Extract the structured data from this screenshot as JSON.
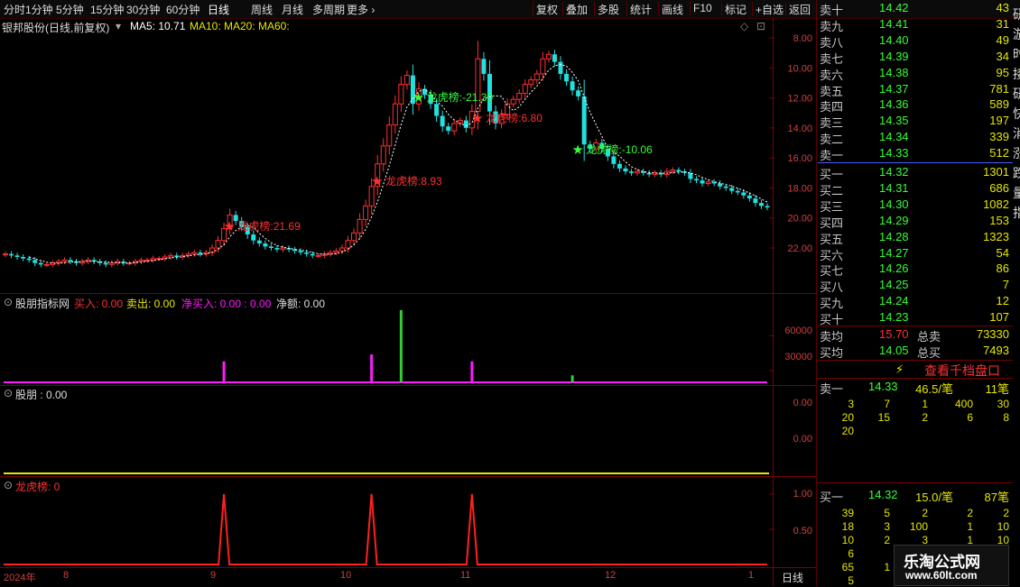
{
  "toolbar": {
    "periods": [
      "分时",
      "1分钟",
      "5分钟",
      "15分钟",
      "30分钟",
      "60分钟",
      "日线",
      "周线",
      "月线",
      "多周期",
      "更多"
    ],
    "tools": [
      "复权",
      "叠加",
      "多股",
      "统计",
      "画线",
      "F10",
      "标记",
      "+自选",
      "返回"
    ]
  },
  "main_chart": {
    "stock_label": "银邦股份(日线,前复权)",
    "ma5": "MA5: 10.71",
    "ma10": "MA10:",
    "ma20": "MA20:",
    "ma60": "MA60:",
    "annotations": [
      {
        "text": "★ 龙虎榜:21.69",
        "price": 9.2,
        "idx": 37,
        "color": "#ff3030"
      },
      {
        "text": "★ 龙虎榜:8.93",
        "price": 12.2,
        "idx": 62,
        "color": "#ff3030"
      },
      {
        "text": "★ 龙虎榜:-21.30",
        "price": 17.8,
        "idx": 69,
        "color": "#33ff33"
      },
      {
        "text": "★ 龙虎榜:6.80",
        "price": 16.4,
        "idx": 79,
        "color": "#ff3030"
      },
      {
        "text": "★ 龙虎榜:-10.06",
        "price": 14.3,
        "idx": 96,
        "color": "#33ff33"
      }
    ],
    "y_ticks": [
      "22.00",
      "20.00",
      "18.00",
      "16.00",
      "14.00",
      "12.00",
      "10.00",
      "8.00"
    ]
  },
  "chart_data": [
    {
      "type": "candlestick",
      "title": "银邦股份(日线,前复权)",
      "ylim": [
        6.5,
        22.6
      ],
      "y_ticks": [
        8,
        10,
        12,
        14,
        16,
        18,
        20,
        22
      ],
      "x_labels": [
        "2024年",
        "8",
        "9",
        "10",
        "11",
        "12",
        "1"
      ],
      "close": [
        7.6,
        7.5,
        7.4,
        7.3,
        7.2,
        7.0,
        6.9,
        6.9,
        7.0,
        7.1,
        7.2,
        7.1,
        7.0,
        7.1,
        7.2,
        7.1,
        7.0,
        6.9,
        7.0,
        7.1,
        7.0,
        7.0,
        7.1,
        7.2,
        7.2,
        7.3,
        7.3,
        7.4,
        7.5,
        7.4,
        7.5,
        7.6,
        7.7,
        7.6,
        7.7,
        8.0,
        8.5,
        9.3,
        10.2,
        9.8,
        9.4,
        8.9,
        8.5,
        8.3,
        8.1,
        8.0,
        7.9,
        8.0,
        7.9,
        7.8,
        7.7,
        7.6,
        7.5,
        7.5,
        7.6,
        7.7,
        7.8,
        8.0,
        8.5,
        9.0,
        9.9,
        10.8,
        12.1,
        13.6,
        14.8,
        16.2,
        17.6,
        18.9,
        19.5,
        17.6,
        18.6,
        18.2,
        17.6,
        16.8,
        16.1,
        15.8,
        16.3,
        16.5,
        16.0,
        17.1,
        20.6,
        19.6,
        17.1,
        16.3,
        16.9,
        17.6,
        17.9,
        18.3,
        18.9,
        19.2,
        19.6,
        20.6,
        20.9,
        20.4,
        19.6,
        19.1,
        18.5,
        18.1,
        14.9,
        14.6,
        15.0,
        14.6,
        14.1,
        13.6,
        13.3,
        13.1,
        13.0,
        13.1,
        13.0,
        12.9,
        13.0,
        12.9,
        13.1,
        13.2,
        13.1,
        13.0,
        12.6,
        12.5,
        12.3,
        12.4,
        12.3,
        12.1,
        12.0,
        11.8,
        11.7,
        11.5,
        11.3,
        11.0,
        10.8,
        10.7
      ]
    },
    {
      "type": "bar",
      "title": "股朋指标网",
      "ylim": [
        20000,
        85000
      ],
      "y_ticks": [
        30000,
        60000
      ],
      "series": [
        {
          "name": "买入",
          "values": [
            {
              "idx": 37,
              "v": 38000,
              "color": "#ff1aff"
            },
            {
              "idx": 62,
              "v": 44000,
              "color": "#ff1aff"
            },
            {
              "idx": 67,
              "v": 82000,
              "color": "#33cc33"
            },
            {
              "idx": 79,
              "v": 38000,
              "color": "#ff1aff"
            },
            {
              "idx": 96,
              "v": 26000,
              "color": "#33cc33"
            }
          ]
        }
      ]
    },
    {
      "type": "line",
      "title": "龙虎榜",
      "ylim": [
        0,
        1.1
      ],
      "y_ticks": [
        0.5,
        1.0
      ],
      "spikes": [
        37,
        62,
        79
      ]
    }
  ],
  "sub1": {
    "title": "股朋指标网",
    "buy": "买入: 0.00",
    "sell": "卖出: 0.00",
    "netbuy": "净买入: 0.00 : 0.00",
    "netamt": "净额: 0.00",
    "ticks": [
      "60000",
      "30000"
    ]
  },
  "sub2": {
    "title": "股朋 : 0.00",
    "ticks": [
      "0.00",
      "0.00"
    ]
  },
  "sub3": {
    "title": "龙虎榜: 0",
    "ticks": [
      "1.00",
      "0.50"
    ]
  },
  "xaxis": [
    "2024年",
    "8",
    "9",
    "10",
    "11",
    "12",
    "1"
  ],
  "right_tab": "日线",
  "order_book": {
    "asks": [
      {
        "n": "卖十",
        "p": "14.42",
        "v": "43"
      },
      {
        "n": "卖九",
        "p": "14.41",
        "v": "31"
      },
      {
        "n": "卖八",
        "p": "14.40",
        "v": "49"
      },
      {
        "n": "卖七",
        "p": "14.39",
        "v": "34"
      },
      {
        "n": "卖六",
        "p": "14.38",
        "v": "95"
      },
      {
        "n": "卖五",
        "p": "14.37",
        "v": "781"
      },
      {
        "n": "卖四",
        "p": "14.36",
        "v": "589"
      },
      {
        "n": "卖三",
        "p": "14.35",
        "v": "197"
      },
      {
        "n": "卖二",
        "p": "14.34",
        "v": "339"
      },
      {
        "n": "卖一",
        "p": "14.33",
        "v": "512"
      }
    ],
    "bids": [
      {
        "n": "买一",
        "p": "14.32",
        "v": "1301"
      },
      {
        "n": "买二",
        "p": "14.31",
        "v": "686"
      },
      {
        "n": "买三",
        "p": "14.30",
        "v": "1082"
      },
      {
        "n": "买四",
        "p": "14.29",
        "v": "153"
      },
      {
        "n": "买五",
        "p": "14.28",
        "v": "1323"
      },
      {
        "n": "买六",
        "p": "14.27",
        "v": "54"
      },
      {
        "n": "买七",
        "p": "14.26",
        "v": "86"
      },
      {
        "n": "买八",
        "p": "14.25",
        "v": "7"
      },
      {
        "n": "买九",
        "p": "14.24",
        "v": "12"
      },
      {
        "n": "买十",
        "p": "14.23",
        "v": "107"
      }
    ],
    "avg_sell_label": "卖均",
    "avg_sell": "15.70",
    "total_sell_label": "总卖",
    "total_sell": "73330",
    "avg_buy_label": "买均",
    "avg_buy": "14.05",
    "total_buy_label": "总买",
    "total_buy": "7493",
    "view_button": "查看千档盘口"
  },
  "queue_sell": {
    "label": "卖一",
    "price": "14.33",
    "avg": "46.5/笔",
    "count": "11笔",
    "rows": [
      [
        "3",
        "7",
        "1",
        "400",
        "30"
      ],
      [
        "20",
        "15",
        "2",
        "6",
        "8"
      ],
      [
        "20",
        "",
        "",
        "",
        ""
      ]
    ]
  },
  "queue_buy": {
    "label": "买一",
    "price": "14.32",
    "avg": "15.0/笔",
    "count": "87笔",
    "rows": [
      [
        "39",
        "5",
        "2",
        "2",
        "2"
      ],
      [
        "18",
        "3",
        "100",
        "1",
        "10"
      ],
      [
        "10",
        "2",
        "3",
        "1",
        "10"
      ],
      [
        "6",
        "",
        "",
        "",
        ""
      ],
      [
        "65",
        "1",
        "",
        "",
        ""
      ],
      [
        "5",
        "",
        "",
        "",
        ""
      ]
    ]
  },
  "side_strip": [
    "研",
    "游",
    "时",
    "接",
    "研",
    "快",
    "消",
    "涨",
    "跌",
    "量",
    "指"
  ],
  "watermark": {
    "title": "乐淘公式网",
    "url": "www.60lt.com"
  },
  "colors": {
    "up": "#ff3030",
    "down": "#22e0e0",
    "ma": "#ffffff",
    "panel": "#7a0000",
    "yellow": "#e6e600",
    "green": "#33ff33",
    "magenta": "#ff1aff"
  }
}
